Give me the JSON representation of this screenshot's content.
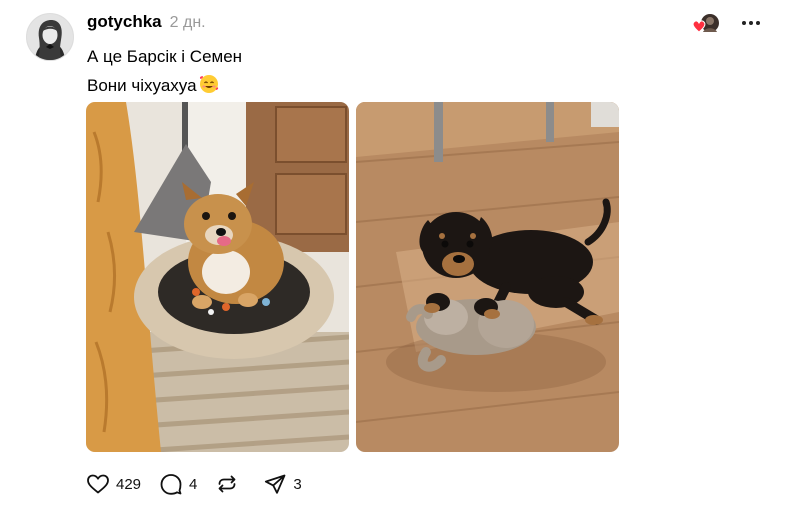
{
  "post": {
    "username": "gotychka",
    "time": "2 дн.",
    "lines": [
      "А це Барсік і Семен",
      "Вони чіхуахуа"
    ],
    "emoji": "smiling-face-with-hearts"
  },
  "photos": [
    {
      "subject": "tan chihuahua on round fluffy pet bed"
    },
    {
      "subject": "black and tan puppy with plush toy on wooden floor"
    }
  ],
  "actions": {
    "likes": "429",
    "comments": "4",
    "reposts": "",
    "shares": "3"
  },
  "icons": {
    "like": "heart-icon",
    "comment": "comment-icon",
    "repost": "repost-icon",
    "share": "send-icon",
    "more": "more-icon"
  },
  "colors": {
    "text": "#000000",
    "muted": "#999999",
    "heart": "#ff3040"
  }
}
